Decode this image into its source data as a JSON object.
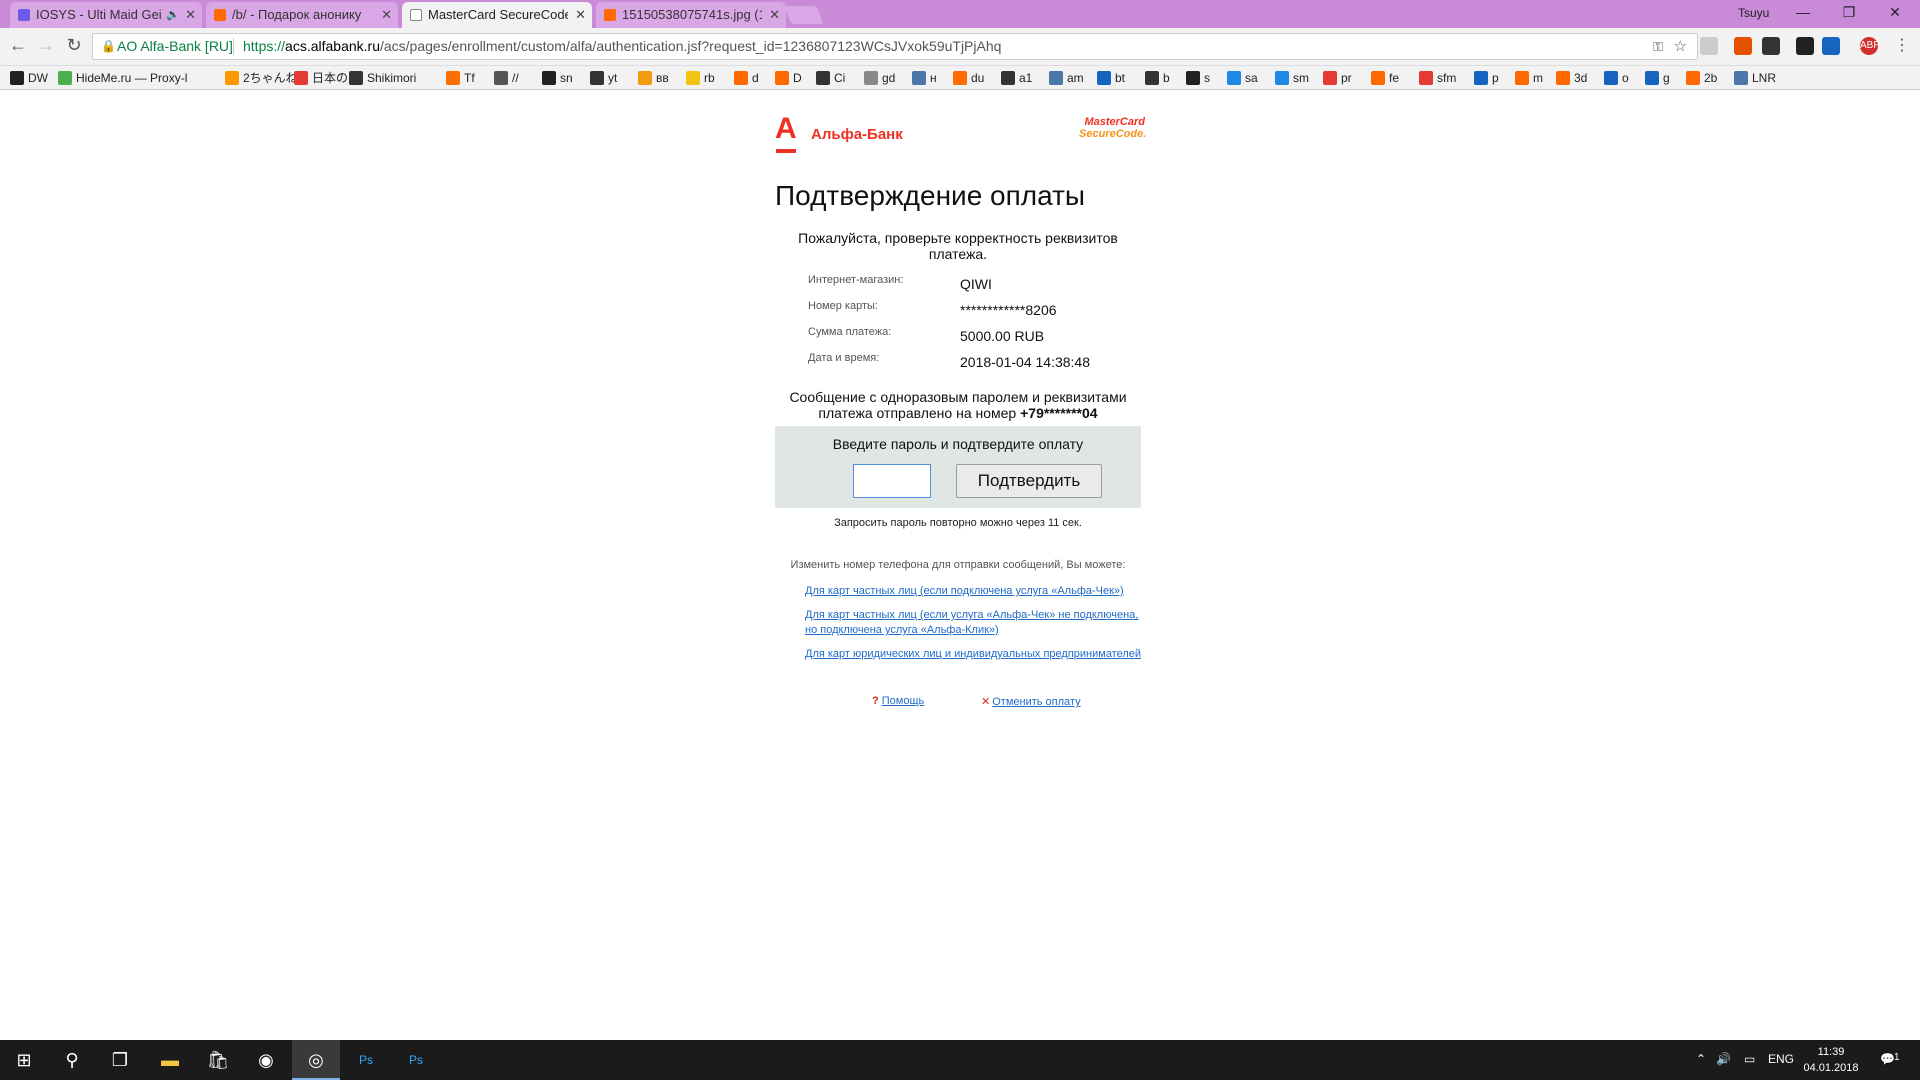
{
  "browser": {
    "tabs": [
      {
        "title": "IOSYS - Ulti Maid Gei",
        "favicon_color": "#6c5ce7",
        "has_audio": true
      },
      {
        "title": "/b/ - Подарок анонику",
        "favicon_color": "#ff6a00"
      },
      {
        "title": "MasterCard SecureCode",
        "favicon_color": "#ffffff",
        "active": true
      },
      {
        "title": "15150538075741s.jpg (1",
        "favicon_color": "#ff6a00"
      }
    ],
    "profile_name": "Tsuyu",
    "window_controls": {
      "minimize": "—",
      "restore": "❐",
      "close": "✕"
    },
    "address_bar": {
      "site_identity": "AO Alfa-Bank [RU]",
      "url_scheme": "https://",
      "url_host": "acs.alfabank.ru",
      "url_path": "/acs/pages/enrollment/custom/alfa/authentication.jsf?request_id=1236807123WCsJVxok59uTjPjAhq"
    },
    "bookmarks": [
      {
        "label": "DW",
        "color": "#222"
      },
      {
        "label": "HideMe.ru — Proxy-l",
        "color": "#4caf50"
      },
      {
        "label": "2ちゃんね",
        "color": "#ff9800"
      },
      {
        "label": "日本の",
        "color": "#e53935"
      },
      {
        "label": "Shikimori",
        "color": "#333"
      },
      {
        "label": "Tf",
        "color": "#ff6f00"
      },
      {
        "label": "//",
        "color": "#555"
      },
      {
        "label": "sn",
        "color": "#222"
      },
      {
        "label": "yt",
        "color": "#333"
      },
      {
        "label": "вв",
        "color": "#f39c12"
      },
      {
        "label": "rb",
        "color": "#f1c40f"
      },
      {
        "label": "d",
        "color": "#ff6a00"
      },
      {
        "label": "D",
        "color": "#ff6a00"
      },
      {
        "label": "Ci",
        "color": "#333"
      },
      {
        "label": "gd",
        "color": "#888"
      },
      {
        "label": "н",
        "color": "#4a76a8"
      },
      {
        "label": "du",
        "color": "#ff6a00"
      },
      {
        "label": "a1",
        "color": "#333"
      },
      {
        "label": "am",
        "color": "#4a76a8"
      },
      {
        "label": "bt",
        "color": "#1565c0"
      },
      {
        "label": "b",
        "color": "#333"
      },
      {
        "label": "s",
        "color": "#222"
      },
      {
        "label": "sa",
        "color": "#1e88e5"
      },
      {
        "label": "sm",
        "color": "#1e88e5"
      },
      {
        "label": "pr",
        "color": "#e53935"
      },
      {
        "label": "fe",
        "color": "#ff6a00"
      },
      {
        "label": "sfm",
        "color": "#e53935"
      },
      {
        "label": "p",
        "color": "#1565c0"
      },
      {
        "label": "m",
        "color": "#ff6a00"
      },
      {
        "label": "3d",
        "color": "#ff6a00"
      },
      {
        "label": "o",
        "color": "#1565c0"
      },
      {
        "label": "g",
        "color": "#1565c0"
      },
      {
        "label": "2b",
        "color": "#ff6a00"
      },
      {
        "label": "LNR",
        "color": "#4a76a8"
      }
    ]
  },
  "page": {
    "bank_logo_text": "Альфа-Банк",
    "mastercard_logo": {
      "line1": "MasterCard",
      "line2": "SecureCode."
    },
    "title": "Подтверждение оплаты",
    "intro": "Пожалуйста, проверьте корректность реквизитов платежа.",
    "details": [
      {
        "label": "Интернет-магазин:",
        "value": "QIWI"
      },
      {
        "label": "Номер карты:",
        "value": "************8206"
      },
      {
        "label": "Сумма платежа:",
        "value": "5000.00 RUB"
      },
      {
        "label": "Дата и время:",
        "value": "2018-01-04 14:38:48"
      }
    ],
    "sms_note_prefix": "Сообщение с одноразовым паролем и реквизитами платежа отправлено на номер",
    "sms_phone": "+79*******04",
    "otp": {
      "title": "Введите пароль и подтвердите оплату",
      "input_value": "",
      "submit_label": "Подтвердить"
    },
    "resend_note": "Запросить пароль повторно можно через 11 сек.",
    "change_phone_note": "Изменить номер телефона для отправки сообщений, Вы можете:",
    "change_phone_links": [
      "Для карт частных лиц (если подключена услуга «Альфа-Чек»)",
      "Для карт частных лиц (если услуга «Альфа-Чек» не подключена, но подключена услуга «Альфа-Клик»)",
      "Для карт юридических лиц и индивидуальных предпринимателей"
    ],
    "help_label": "Помощь",
    "cancel_label": "Отменить оплату"
  },
  "taskbar": {
    "language": "ENG",
    "time": "11:39",
    "date": "04.01.2018",
    "notification_count": "1"
  },
  "colors": {
    "alfa_red": "#ef3124",
    "link_blue": "#1f6bc8",
    "otp_panel_bg": "#e0e6e3",
    "tabstrip_bg": "#c98ad8"
  }
}
